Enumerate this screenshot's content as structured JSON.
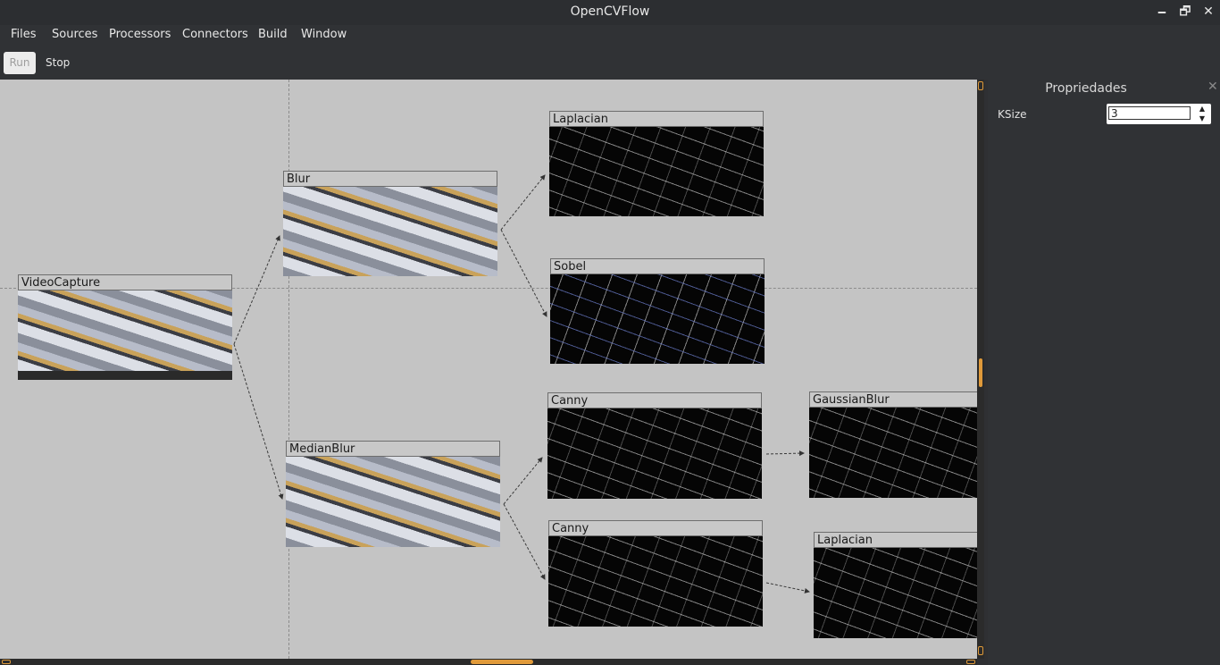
{
  "window": {
    "title": "OpenCVFlow",
    "minimize": "🗕",
    "restore": "🗗",
    "close": "✕"
  },
  "menu": [
    "Files",
    "Sources",
    "Processors",
    "Connectors",
    "Build",
    "Window"
  ],
  "toolbar": {
    "run_label": "Run",
    "stop_label": "Stop"
  },
  "nodes": [
    {
      "title": "VideoCapture",
      "image": "photo"
    },
    {
      "title": "Blur",
      "image": "photo"
    },
    {
      "title": "MedianBlur",
      "image": "photo"
    },
    {
      "title": "Laplacian",
      "image": "edges"
    },
    {
      "title": "Sobel",
      "image": "edges-blue"
    },
    {
      "title": "Canny",
      "image": "edges"
    },
    {
      "title": "Canny",
      "image": "edges"
    },
    {
      "title": "GaussianBlur",
      "image": "edges"
    },
    {
      "title": "Laplacian",
      "image": "edges"
    }
  ],
  "properties": {
    "title": "Propriedades",
    "close": "✕",
    "fields": [
      {
        "label": "KSize",
        "value": "3"
      }
    ]
  },
  "colors": {
    "canvas": "#c4c4c4",
    "chrome": "#303235",
    "accent": "#e09a3a"
  }
}
